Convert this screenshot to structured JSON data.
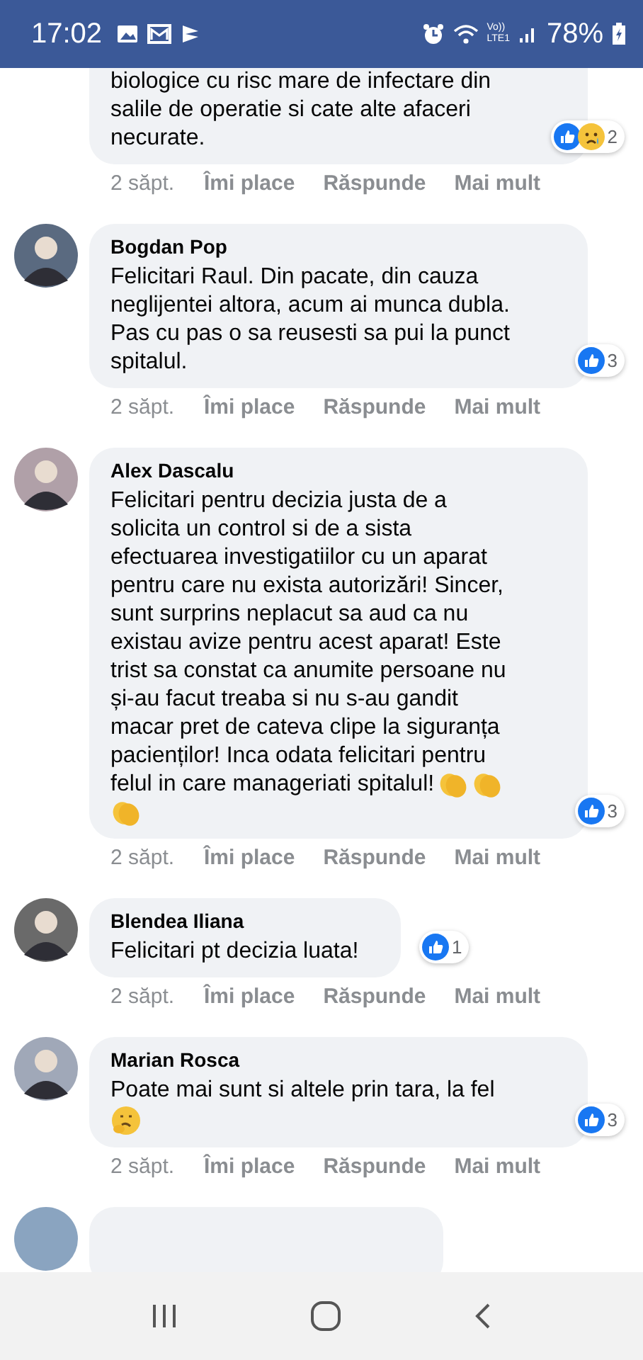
{
  "status_bar": {
    "time": "17:02",
    "volte": "Vo))",
    "network": "LTE1",
    "battery": "78%"
  },
  "comments": [
    {
      "kind": "partial",
      "lines": [
        "biologice cu risc mare de infectare din",
        "salile de operatie si cate alte afaceri",
        "necurate."
      ],
      "reactions": [
        {
          "kind": "like"
        },
        {
          "kind": "sad"
        }
      ],
      "reaction_count": "2",
      "time": "2 săpt.",
      "like": "Îmi place",
      "reply": "Răspunde",
      "more": "Mai mult"
    },
    {
      "kind": "full",
      "name": "Bogdan Pop",
      "lines": [
        "Felicitari Raul. Din pacate, din cauza",
        "neglijentei altora, acum ai munca dubla.",
        "Pas cu pas o sa reusesti sa pui la punct",
        "spitalul."
      ],
      "reactions": [
        {
          "kind": "like"
        }
      ],
      "reaction_count": "3",
      "time": "2 săpt.",
      "like": "Îmi place",
      "reply": "Răspunde",
      "more": "Mai mult"
    },
    {
      "kind": "full",
      "name": "Alex Dascalu",
      "lines": [
        "Felicitari pentru decizia justa de a",
        "solicita un control si de a sista",
        "efectuarea investigatiilor cu un aparat",
        "pentru care nu exista autorizări! Sincer,",
        "sunt surprins neplacut sa aud ca nu",
        "existau avize pentru acest aparat! Este",
        "trist sa constat ca anumite persoane nu",
        "și-au facut treaba si nu s-au gandit",
        "macar pret de cateva clipe la siguranța",
        "pacienților! Inca odata felicitari pentru",
        "felul in care manageriati spitalul!"
      ],
      "emojis": [
        {
          "kind": "clap"
        },
        {
          "kind": "clap"
        },
        {
          "kind": "clap"
        }
      ],
      "reactions": [
        {
          "kind": "like"
        }
      ],
      "reaction_count": "3",
      "time": "2 săpt.",
      "like": "Îmi place",
      "reply": "Răspunde",
      "more": "Mai mult"
    },
    {
      "kind": "short",
      "name": "Blendea Iliana",
      "lines": [
        "Felicitari pt decizia luata!"
      ],
      "reactions": [
        {
          "kind": "like"
        }
      ],
      "reaction_count": "1",
      "time": "2 săpt.",
      "like": "Îmi place",
      "reply": "Răspunde",
      "more": "Mai mult"
    },
    {
      "kind": "full",
      "name": "Marian Rosca",
      "lines": [
        "Poate mai sunt si altele prin tara, la fel"
      ],
      "emojis": [
        {
          "kind": "thinking"
        }
      ],
      "reactions": [
        {
          "kind": "like"
        }
      ],
      "reaction_count": "3",
      "time": "2 săpt.",
      "like": "Îmi place",
      "reply": "Răspunde",
      "more": "Mai mult"
    }
  ],
  "next_comment_peek": true
}
